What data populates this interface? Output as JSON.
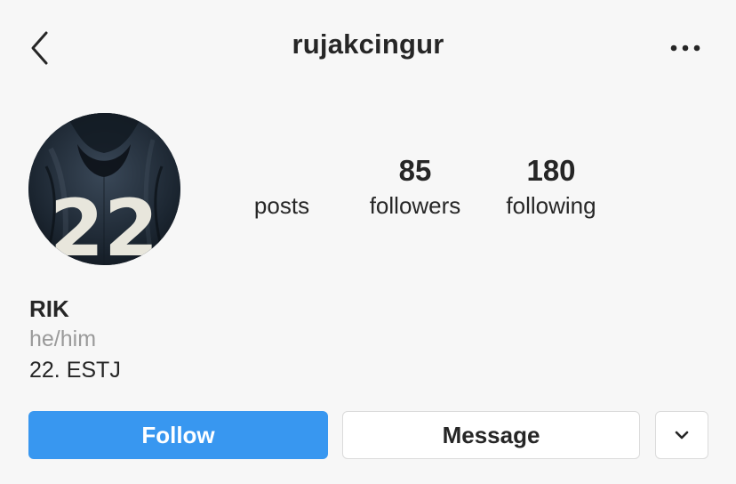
{
  "header": {
    "username": "rujakcingur",
    "back_icon": "chevron-left-icon",
    "more_icon": "more-horizontal-icon"
  },
  "profile": {
    "avatar_text": "22",
    "stats": {
      "posts_count": "",
      "posts_label": "posts",
      "followers_count": "85",
      "followers_label": "followers",
      "following_count": "180",
      "following_label": "following"
    },
    "name": "RIK",
    "pronouns": "he/him",
    "bio": "22. ESTJ"
  },
  "actions": {
    "follow_label": "Follow",
    "message_label": "Message",
    "dropdown_icon": "chevron-down-icon"
  },
  "colors": {
    "background": "#f7f7f7",
    "follow_button": "#3897f0",
    "text_primary": "#262626",
    "text_secondary": "#9a9a9a"
  }
}
